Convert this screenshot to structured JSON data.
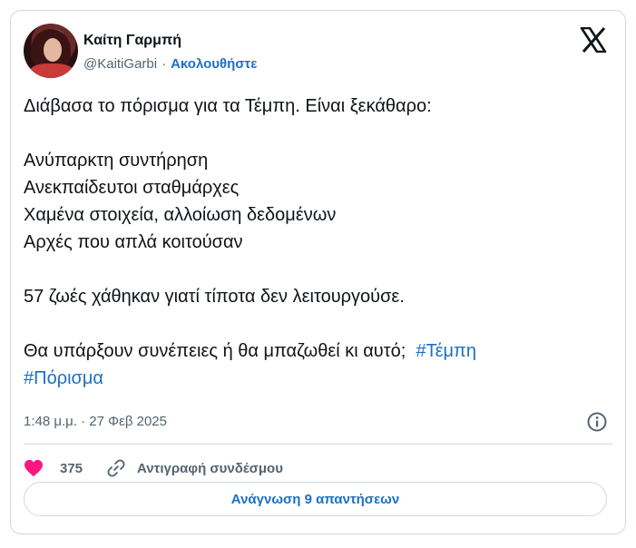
{
  "author": {
    "name": "Καίτη Γαρμπή",
    "handle": "@KaitiGarbi",
    "separator": "·",
    "follow_label": "Ακολουθήστε"
  },
  "tweet": {
    "lines": [
      "Διάβασα το πόρισμα για τα Τέμπη. Είναι ξεκάθαρο:",
      "Ανύπαρκτη συντήρηση",
      "Ανεκπαίδευτοι σταθμάρχες",
      "Χαμένα στοιχεία, αλλοίωση δεδομένων",
      "Αρχές που απλά κοιτούσαν",
      "57 ζωές χάθηκαν γιατί τίποτα δεν λειτουργούσε.",
      "Θα υπάρξουν συνέπειες ή θα μπαζωθεί κι αυτό;"
    ],
    "hashtags": [
      "#Τέμπη",
      "#Πόρισμα"
    ],
    "timestamp": "1:48 μ.μ. · 27 Φεβ 2025"
  },
  "actions": {
    "like_count": "375",
    "copy_link_label": "Αντιγραφή συνδέσμου"
  },
  "replies_button_label": "Ανάγνωση 9 απαντήσεων",
  "colors": {
    "link": "#1d6fc4",
    "secondary_text": "#536471",
    "like": "#f91880",
    "border": "#cfd9de"
  },
  "icons": [
    "x-logo-icon",
    "info-icon",
    "heart-icon",
    "link-icon"
  ]
}
